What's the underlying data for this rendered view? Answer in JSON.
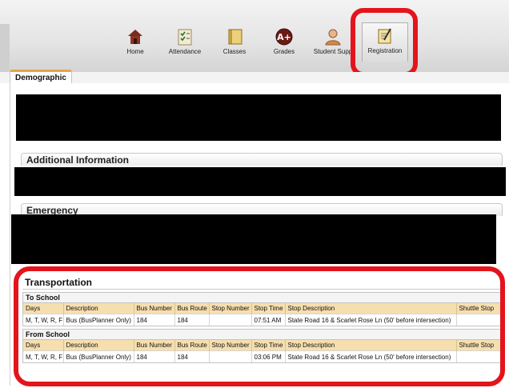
{
  "nav": {
    "items": [
      {
        "label": "Home",
        "icon": "home-icon"
      },
      {
        "label": "Attendance",
        "icon": "attendance-icon"
      },
      {
        "label": "Classes",
        "icon": "classes-icon"
      },
      {
        "label": "Grades",
        "icon": "grades-icon"
      },
      {
        "label": "Student Supp",
        "icon": "student-support-icon"
      },
      {
        "label": "Registration",
        "icon": "registration-icon"
      }
    ],
    "active": "Registration"
  },
  "tabs": {
    "active_label": "Demographic"
  },
  "sections": {
    "additional": "Additional Information",
    "emergency": "Emergency"
  },
  "transportation": {
    "title": "Transportation",
    "columns": [
      "Days",
      "Description",
      "Bus Number",
      "Bus Route",
      "Stop Number",
      "Stop Time",
      "Stop Description",
      "Shuttle Stop"
    ],
    "groups": [
      {
        "title": "To School",
        "row": [
          "M, T, W, R, F",
          "Bus (BusPlanner Only)",
          "184",
          "184",
          "",
          "07:51 AM",
          "State Road 16 & Scarlet Rose Ln (50' before intersection)",
          ""
        ]
      },
      {
        "title": "From School",
        "row": [
          "M, T, W, R, F",
          "Bus (BusPlanner Only)",
          "184",
          "184",
          "",
          "03:06 PM",
          "State Road 16 & Scarlet Rose Ln (50' before intersection)",
          ""
        ]
      }
    ]
  },
  "colors": {
    "highlight": "#e4141c",
    "table_header": "#f6dfaf",
    "tab_accent": "#e9a24a"
  }
}
